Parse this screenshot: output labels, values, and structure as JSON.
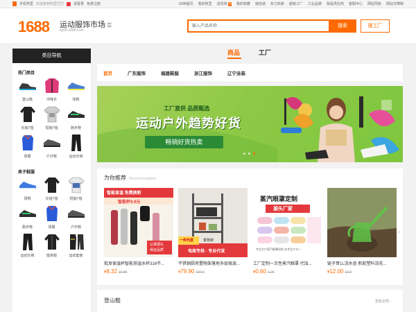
{
  "topbar": {
    "left": [
      "手机阿里",
      "欢迎来到阿里巴巴",
      "请登录",
      "免费注册"
    ],
    "right": [
      "1688首页",
      "我的阿里",
      "进货单",
      "我的收藏",
      "诚信通",
      "实力商家",
      "超级工厂",
      "工业品牌",
      "我是供应商",
      "客服中心",
      "网站导航",
      "网站无障碍"
    ],
    "badge_new": "6"
  },
  "header": {
    "logo": "1688",
    "site_name": "运动服饰市场",
    "site_url": "sport.1688.com",
    "search_placeholder": "输入产品名称",
    "search_button": "搜索",
    "factory_button": "搜工厂"
  },
  "sidebar": {
    "title": "类目导航",
    "groups": [
      {
        "heading": "热门类目",
        "items": [
          {
            "label": "登山鞋",
            "icon": "hiking-shoe-icon"
          },
          {
            "label": "冲锋衣",
            "icon": "jacket-icon"
          },
          {
            "label": "球鞋",
            "icon": "sneaker-icon"
          },
          {
            "label": "长袖T恤",
            "icon": "longsleeve-shirt-icon"
          },
          {
            "label": "短袖T恤",
            "icon": "tshirt-icon"
          },
          {
            "label": "跑步鞋",
            "icon": "running-shoe-icon"
          },
          {
            "label": "球服",
            "icon": "jersey-icon"
          },
          {
            "label": "户外鞋",
            "icon": "outdoor-shoe-icon"
          },
          {
            "label": "运动长裤",
            "icon": "pants-icon"
          }
        ]
      },
      {
        "heading": "男子鞋服",
        "items": [
          {
            "label": "球鞋",
            "icon": "sneaker-icon"
          },
          {
            "label": "长袖T恤",
            "icon": "longsleeve-shirt-icon"
          },
          {
            "label": "短袖T恤",
            "icon": "tshirt-icon"
          },
          {
            "label": "跑步鞋",
            "icon": "running-shoe-icon"
          },
          {
            "label": "球服",
            "icon": "jersey-icon"
          },
          {
            "label": "户外鞋",
            "icon": "outdoor-shoe-icon"
          },
          {
            "label": "运动长裤",
            "icon": "pants-icon"
          },
          {
            "label": "健身服",
            "icon": "fitness-wear-icon"
          },
          {
            "label": "运动套装",
            "icon": "tracksuit-icon"
          }
        ]
      }
    ]
  },
  "tabs": {
    "products": "商品",
    "factory": "工厂"
  },
  "subnav": [
    "首页",
    "广东服饰",
    "福建鞋服",
    "浙江服饰",
    "辽宁泳装"
  ],
  "banner": {
    "line1": "工厂直供 品质甄选",
    "line2": "运动户外趋势好货",
    "line3": "畅销好货热卖"
  },
  "recommend": {
    "title": "为你推荐",
    "subtitle": "Recommendation",
    "products": [
      {
        "name": "批发保温杯智能测温水杯316不...",
        "currency": "¥",
        "price": "8.32",
        "old_price": "16.88",
        "img_text_1": "智能显温 免费换新",
        "img_text_2": "智能杯9.9元",
        "img_text_3": "认准源头",
        "img_text_4": "保证品质"
      },
      {
        "name": "不锈钢厨房置物架落地多层微波...",
        "currency": "¥",
        "price": "79.90",
        "old_price": "150.0",
        "img_text_1": "置物架",
        "img_text_2": "一件代发",
        "img_text_3": "电商专供 · 专业代发"
      },
      {
        "name": "工厂定制一次性蒸汽眼罩 代加...",
        "currency": "¥",
        "price": "0.60",
        "old_price": "1.26",
        "img_text_1": "蒸汽眼罩定制",
        "img_text_2": "源头厂家",
        "img_text_3": "专业生产蒸汽眼罩研发 技术生产为一"
      },
      {
        "name": "链子哥1L浇水壶 新款塑料浇花...",
        "currency": "¥",
        "price": "12.00",
        "old_price": "13.0"
      }
    ]
  },
  "section2": {
    "title": "登山鞋",
    "more": "查看全部"
  },
  "colors": {
    "accent": "#ff6a00",
    "banner_green": "#8ec945",
    "dark": "#222222"
  }
}
